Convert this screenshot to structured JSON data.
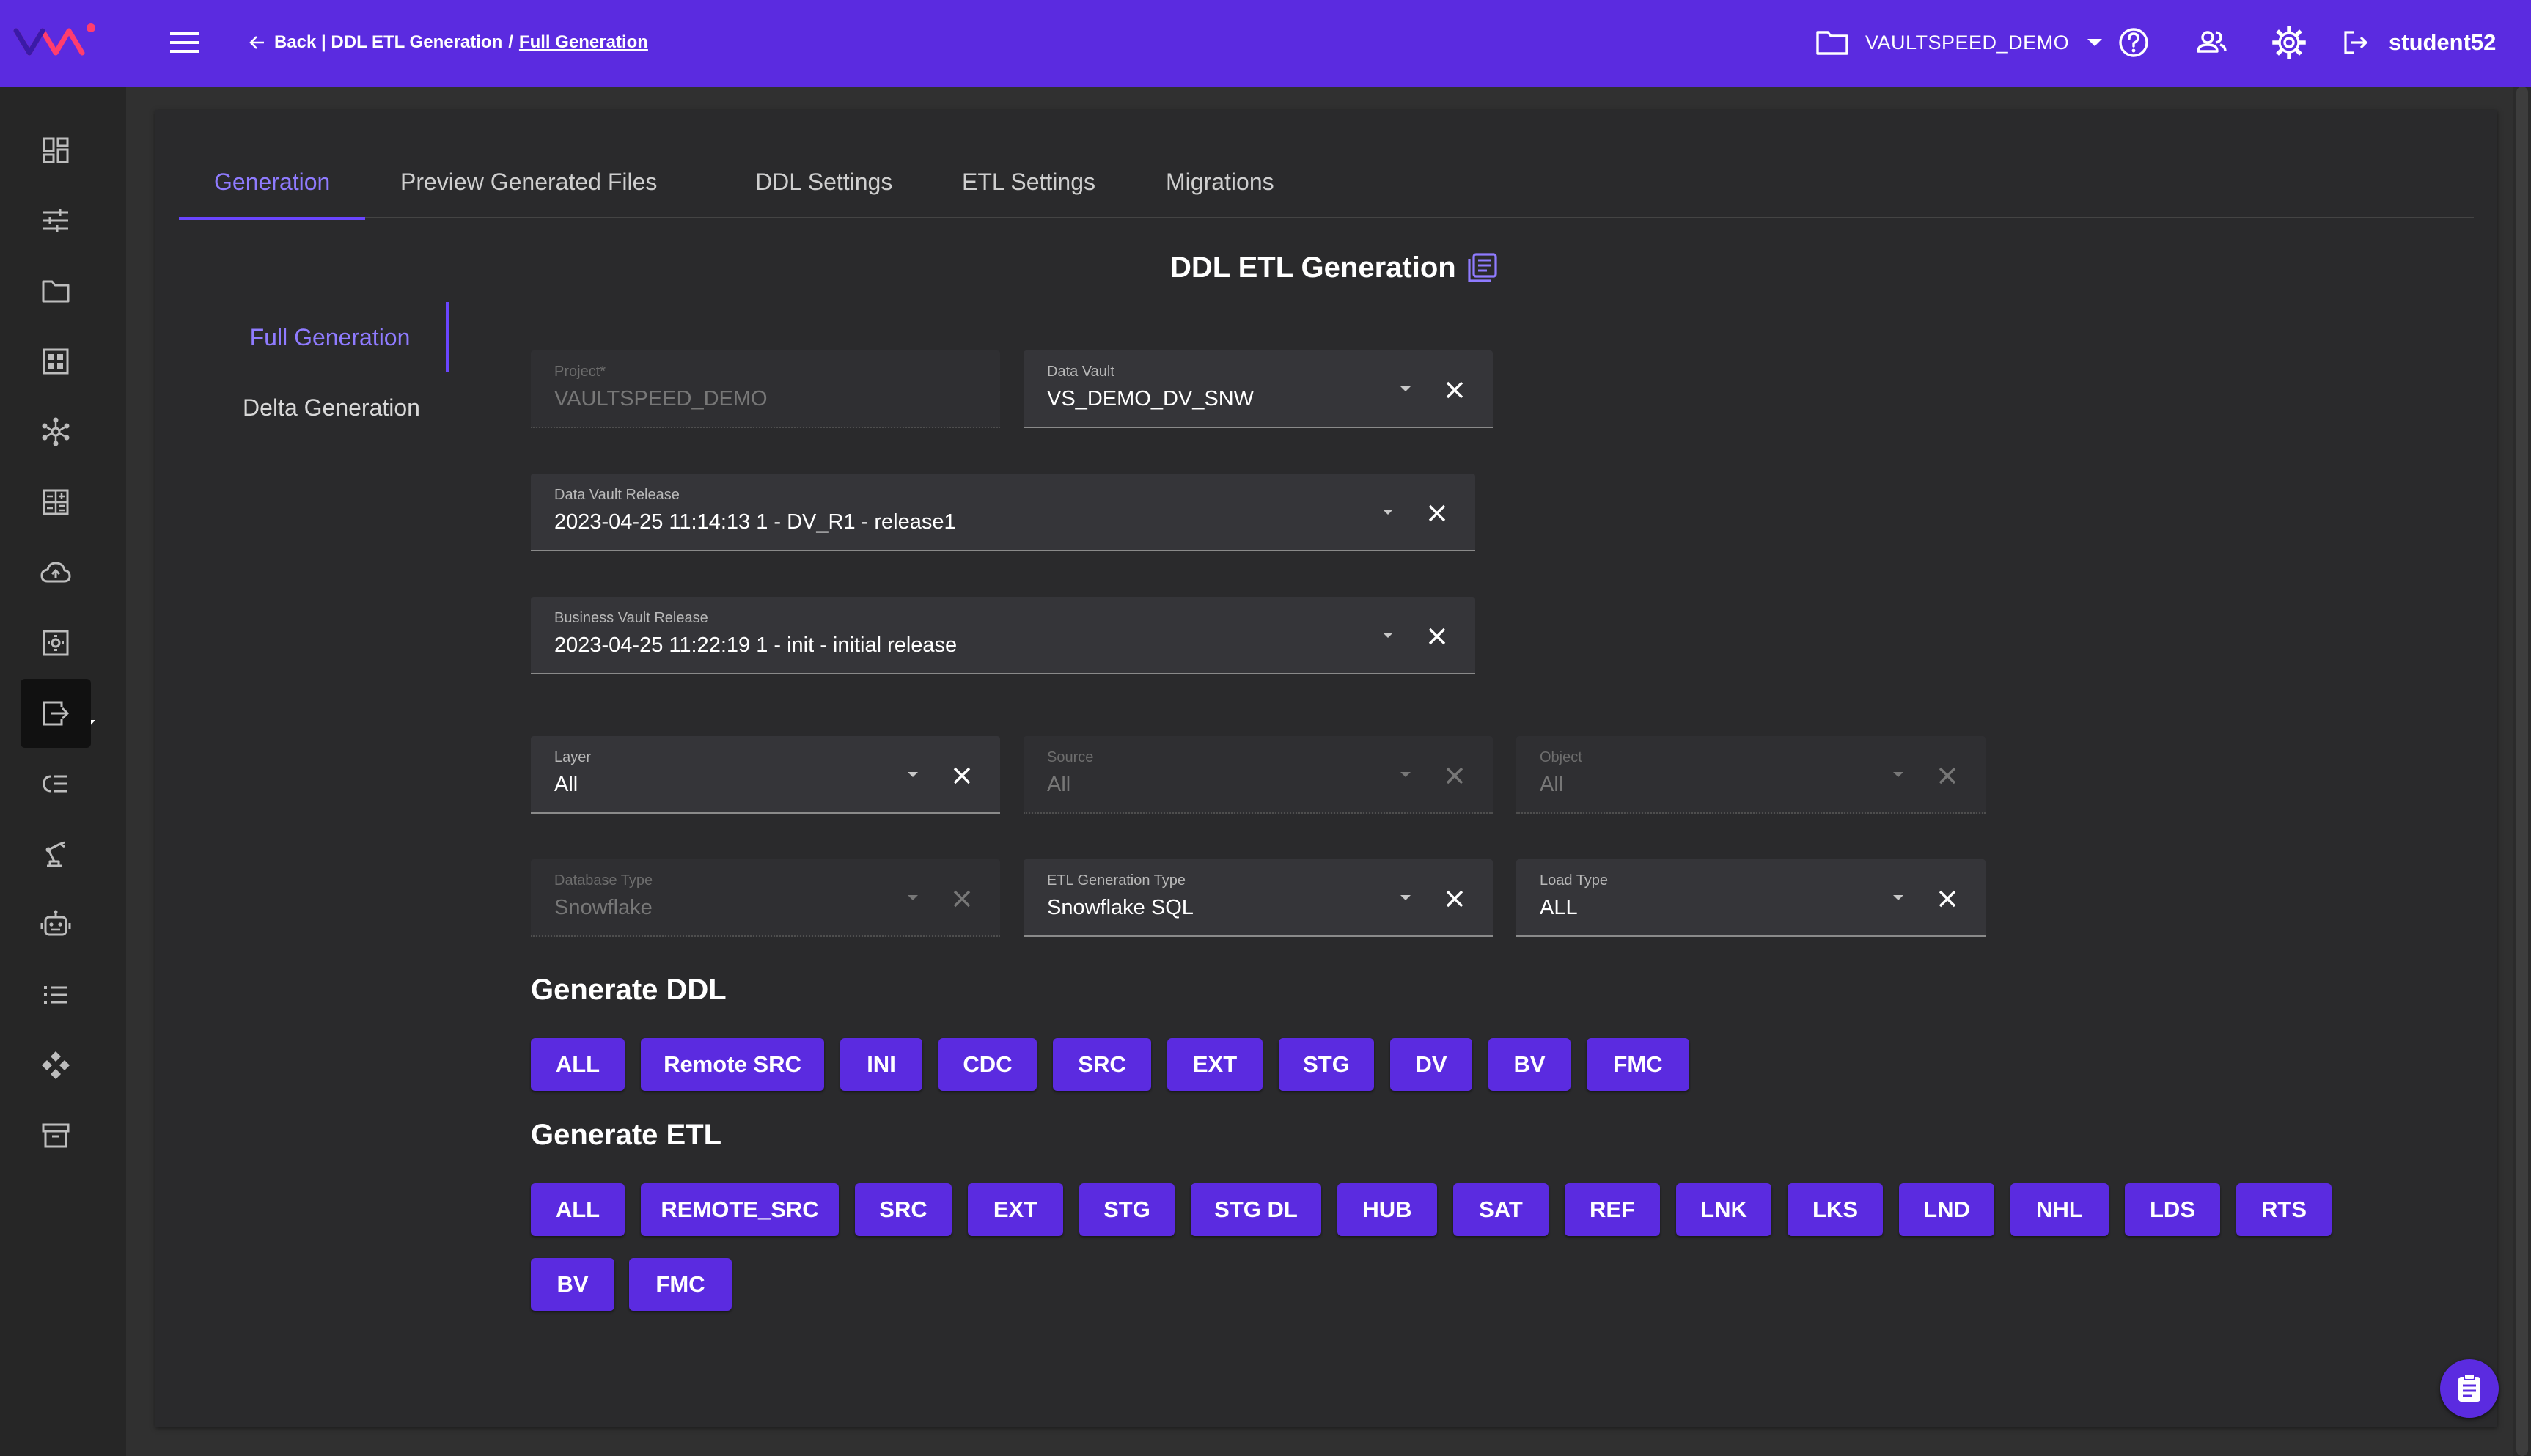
{
  "topbar": {
    "breadcrumb_back": "Back | DDL ETL Generation",
    "breadcrumb_sep": "/",
    "breadcrumb_current": "Full Generation",
    "project_name": "VAULTSPEED_DEMO",
    "username": "student52",
    "bg_color": "#5b2be0"
  },
  "sidebar": {
    "icons": [
      "dashboard-icon",
      "tune-icon",
      "folder-icon",
      "grid-icon",
      "hub-network-icon",
      "calculator-icon",
      "cloud-upload-icon",
      "settings-box-icon",
      "export-icon",
      "list-tree-icon",
      "robot-arm-icon",
      "robot-icon",
      "list-icon",
      "move-icon",
      "archive-icon"
    ],
    "active_index": 8
  },
  "tabs": [
    "Generation",
    "Preview Generated Files",
    "DDL Settings",
    "ETL Settings",
    "Migrations"
  ],
  "active_tab": 0,
  "page_title": "DDL ETL Generation",
  "subnav": [
    "Full Generation",
    "Delta Generation"
  ],
  "fields": {
    "project": {
      "label": "Project*",
      "value": "VAULTSPEED_DEMO"
    },
    "data_vault": {
      "label": "Data Vault",
      "value": "VS_DEMO_DV_SNW"
    },
    "dv_release": {
      "label": "Data Vault Release",
      "value": "2023-04-25 11:14:13 1 - DV_R1 - release1"
    },
    "bv_release": {
      "label": "Business Vault Release",
      "value": "2023-04-25 11:22:19 1 - init - initial release"
    },
    "layer": {
      "label": "Layer",
      "value": "All"
    },
    "source": {
      "label": "Source",
      "value": "All"
    },
    "object": {
      "label": "Object",
      "value": "All"
    },
    "db_type": {
      "label": "Database Type",
      "value": "Snowflake"
    },
    "etl_type": {
      "label": "ETL Generation Type",
      "value": "Snowflake SQL"
    },
    "load_type": {
      "label": "Load Type",
      "value": "ALL"
    }
  },
  "generate_ddl": {
    "title": "Generate DDL",
    "buttons": [
      "ALL",
      "Remote SRC",
      "INI",
      "CDC",
      "SRC",
      "EXT",
      "STG",
      "DV",
      "BV",
      "FMC"
    ]
  },
  "generate_etl": {
    "title": "Generate ETL",
    "buttons": [
      "ALL",
      "REMOTE_SRC",
      "SRC",
      "EXT",
      "STG",
      "STG DL",
      "HUB",
      "SAT",
      "REF",
      "LNK",
      "LKS",
      "LND",
      "NHL",
      "LDS",
      "RTS",
      "BV",
      "FMC"
    ]
  },
  "colors": {
    "accent": "#5b2be0",
    "active_tab": "#8f7bff",
    "background": "#303030",
    "panel": "#2a2a2c"
  }
}
